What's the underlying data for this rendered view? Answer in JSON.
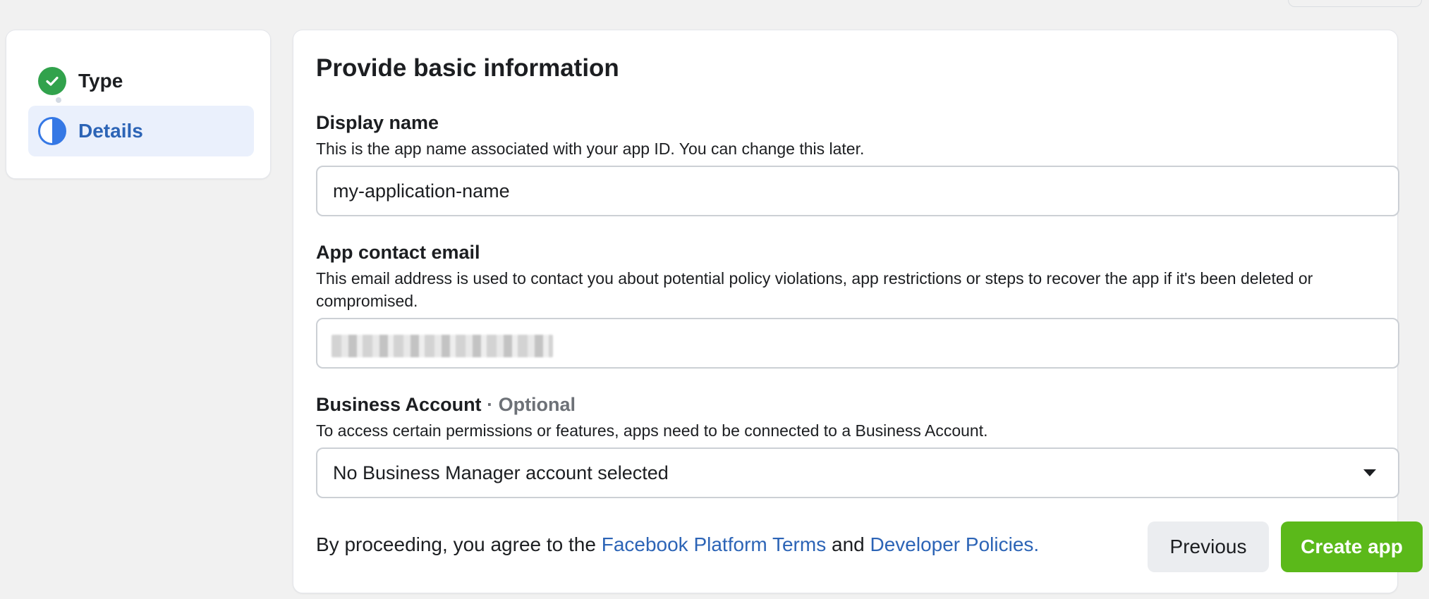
{
  "steps": [
    {
      "label": "Type",
      "status": "complete",
      "icon": "check-circle-icon"
    },
    {
      "label": "Details",
      "status": "in-progress",
      "icon": "half-circle-icon"
    }
  ],
  "form": {
    "title": "Provide basic information",
    "display_name": {
      "label": "Display name",
      "help": "This is the app name associated with your app ID. You can change this later.",
      "value": "my-application-name"
    },
    "contact_email": {
      "label": "App contact email",
      "help": "This email address is used to contact you about potential policy violations, app restrictions or steps to recover the app if it's been deleted or compromised.",
      "value": ""
    },
    "business_account": {
      "label": "Business Account",
      "optional": "· Optional",
      "help": "To access certain permissions or features, apps need to be connected to a Business Account.",
      "selected": "No Business Manager account selected"
    }
  },
  "footer": {
    "agree_prefix": "By proceeding, you agree to the",
    "terms_link": "Facebook Platform Terms",
    "and": "and",
    "policies_link": "Developer Policies."
  },
  "buttons": {
    "previous": "Previous",
    "create": "Create app"
  },
  "colors": {
    "accent_green": "#5bb91a",
    "step_complete": "#31a24c",
    "step_active": "#3578e5",
    "link": "#2c64b6"
  }
}
